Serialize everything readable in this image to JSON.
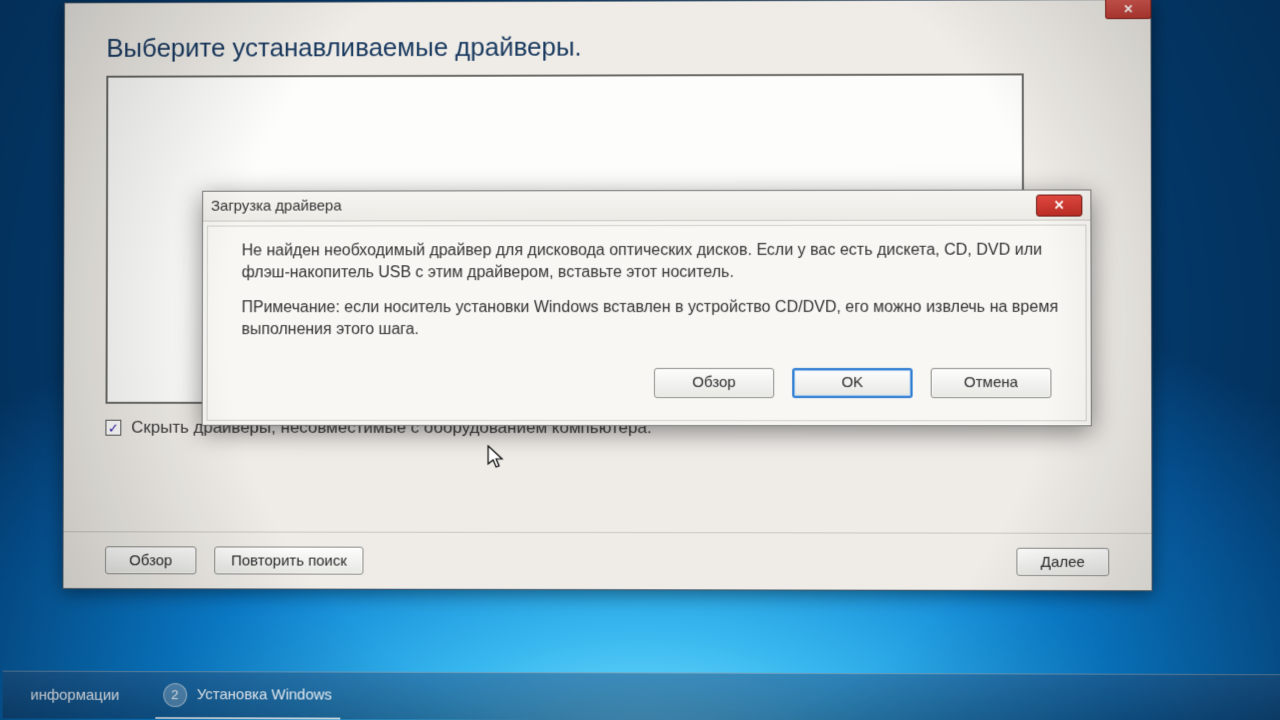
{
  "installer": {
    "page_title": "Выберите устанавливаемые драйверы.",
    "hide_incompatible_label": "Скрыть драйверы, несовместимые с оборудованием компьютера.",
    "hide_incompatible_checked": true,
    "buttons": {
      "browse": "Обзор",
      "rescan": "Повторить поиск",
      "next": "Далее"
    }
  },
  "modal": {
    "title": "Загрузка драйвера",
    "paragraph1": "Не найден необходимый драйвер для дисковода оптических дисков. Если у вас есть дискета, CD, DVD или флэш-накопитель USB с этим драйвером, вставьте этот носитель.",
    "paragraph2": "ПРимечание: если носитель установки Windows вставлен в устройство CD/DVD, его можно извлечь на время выполнения этого шага.",
    "buttons": {
      "browse": "Обзор",
      "ok": "OK",
      "cancel": "Отмена"
    }
  },
  "taskbar": {
    "step1_label": "информации",
    "step2_num": "2",
    "step2_label": "Установка Windows"
  }
}
